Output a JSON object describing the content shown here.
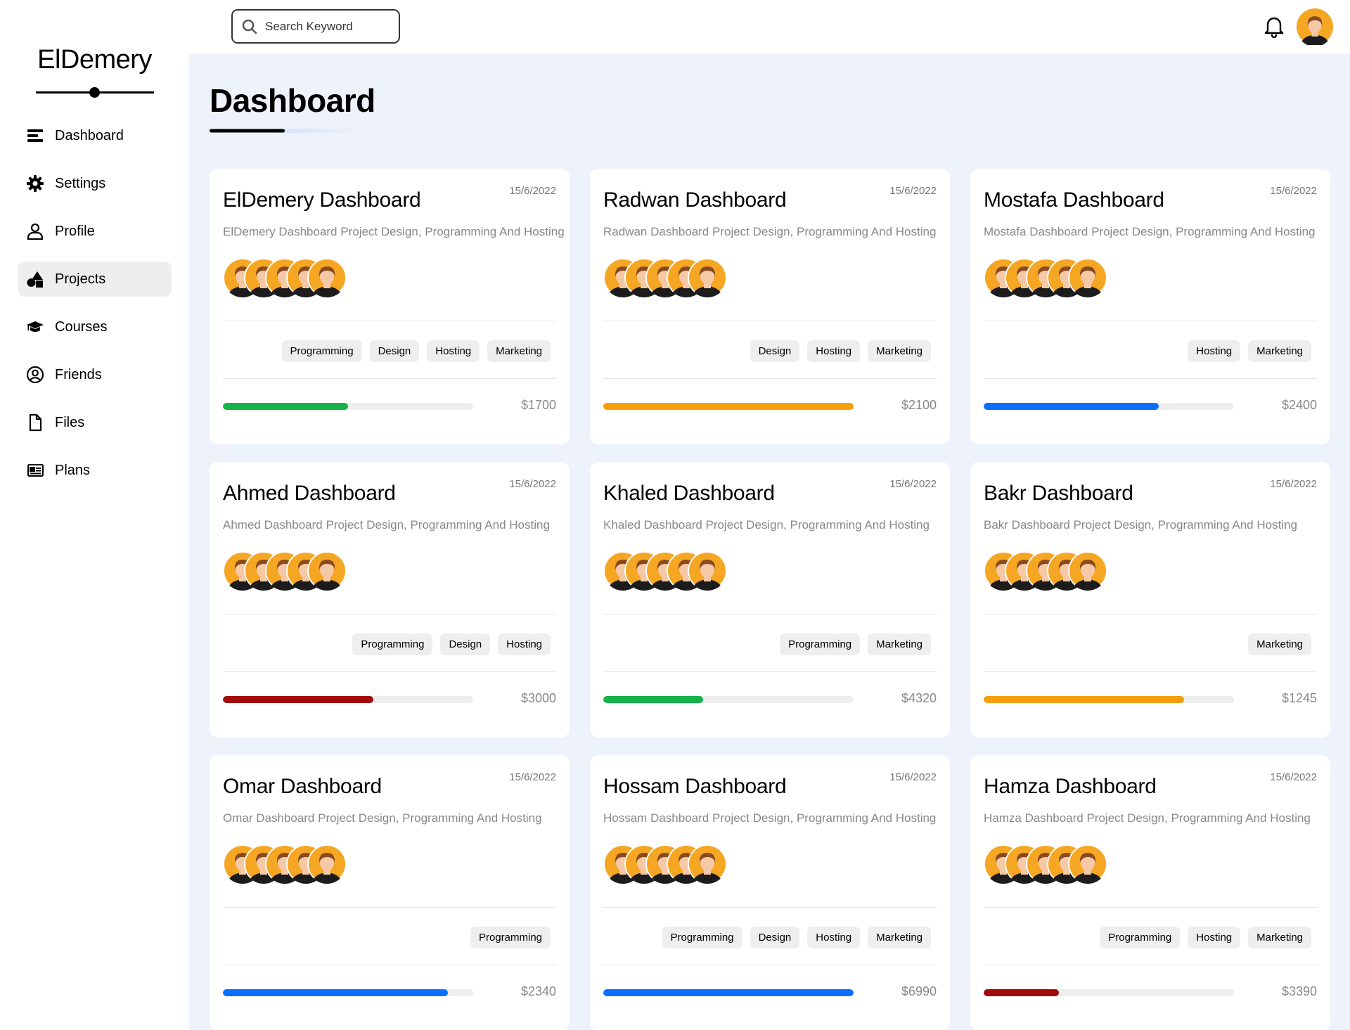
{
  "brand": {
    "name": "ElDemery"
  },
  "sidebar": {
    "items": [
      {
        "label": "Dashboard",
        "icon": "menu-bars-icon",
        "active": false
      },
      {
        "label": "Settings",
        "icon": "gear-icon",
        "active": false
      },
      {
        "label": "Profile",
        "icon": "user-icon",
        "active": false
      },
      {
        "label": "Projects",
        "icon": "shapes-icon",
        "active": true
      },
      {
        "label": "Courses",
        "icon": "graduation-cap-icon",
        "active": false
      },
      {
        "label": "Friends",
        "icon": "user-circle-icon",
        "active": false
      },
      {
        "label": "Files",
        "icon": "file-icon",
        "active": false
      },
      {
        "label": "Plans",
        "icon": "newspaper-icon",
        "active": false
      }
    ]
  },
  "header": {
    "search": {
      "placeholder": "Search Keyword"
    }
  },
  "page": {
    "title": "Dashboard"
  },
  "colors": {
    "green": "#16b34a",
    "orange": "#f59e0b",
    "blue": "#0d6efd",
    "red": "#a20b0b",
    "avatar_bg": "#f5a623"
  },
  "projects": [
    {
      "title": "ElDemery Dashboard",
      "date": "15/6/2022",
      "description": "ElDemery Dashboard Project Design, Programming And Hosting",
      "tags": [
        "Programming",
        "Design",
        "Hosting",
        "Marketing"
      ],
      "progress": 0.5,
      "color": "#16b34a",
      "price": "$1700"
    },
    {
      "title": "Radwan Dashboard",
      "date": "15/6/2022",
      "description": "Radwan Dashboard Project Design, Programming And Hosting",
      "tags": [
        "Design",
        "Hosting",
        "Marketing"
      ],
      "progress": 1.0,
      "color": "#f59e0b",
      "price": "$2100"
    },
    {
      "title": "Mostafa Dashboard",
      "date": "15/6/2022",
      "description": "Mostafa Dashboard Project Design, Programming And Hosting",
      "tags": [
        "Hosting",
        "Marketing"
      ],
      "progress": 0.7,
      "color": "#0d6efd",
      "price": "$2400"
    },
    {
      "title": "Ahmed Dashboard",
      "date": "15/6/2022",
      "description": "Ahmed Dashboard Project Design, Programming And Hosting",
      "tags": [
        "Programming",
        "Design",
        "Hosting"
      ],
      "progress": 0.6,
      "color": "#a20b0b",
      "price": "$3000"
    },
    {
      "title": "Khaled Dashboard",
      "date": "15/6/2022",
      "description": "Khaled Dashboard Project Design, Programming And Hosting",
      "tags": [
        "Programming",
        "Marketing"
      ],
      "progress": 0.4,
      "color": "#16b34a",
      "price": "$4320"
    },
    {
      "title": "Bakr Dashboard",
      "date": "15/6/2022",
      "description": "Bakr Dashboard Project Design, Programming And Hosting",
      "tags": [
        "Marketing"
      ],
      "progress": 0.8,
      "color": "#f59e0b",
      "price": "$1245"
    },
    {
      "title": "Omar Dashboard",
      "date": "15/6/2022",
      "description": "Omar Dashboard Project Design, Programming And Hosting",
      "tags": [
        "Programming"
      ],
      "progress": 0.9,
      "color": "#0d6efd",
      "price": "$2340"
    },
    {
      "title": "Hossam Dashboard",
      "date": "15/6/2022",
      "description": "Hossam Dashboard Project Design, Programming And Hosting",
      "tags": [
        "Programming",
        "Design",
        "Hosting",
        "Marketing"
      ],
      "progress": 1.0,
      "color": "#0d6efd",
      "price": "$6990"
    },
    {
      "title": "Hamza Dashboard",
      "date": "15/6/2022",
      "description": "Hamza Dashboard Project Design, Programming And Hosting",
      "tags": [
        "Programming",
        "Hosting",
        "Marketing"
      ],
      "progress": 0.3,
      "color": "#a20b0b",
      "price": "$3390"
    }
  ]
}
